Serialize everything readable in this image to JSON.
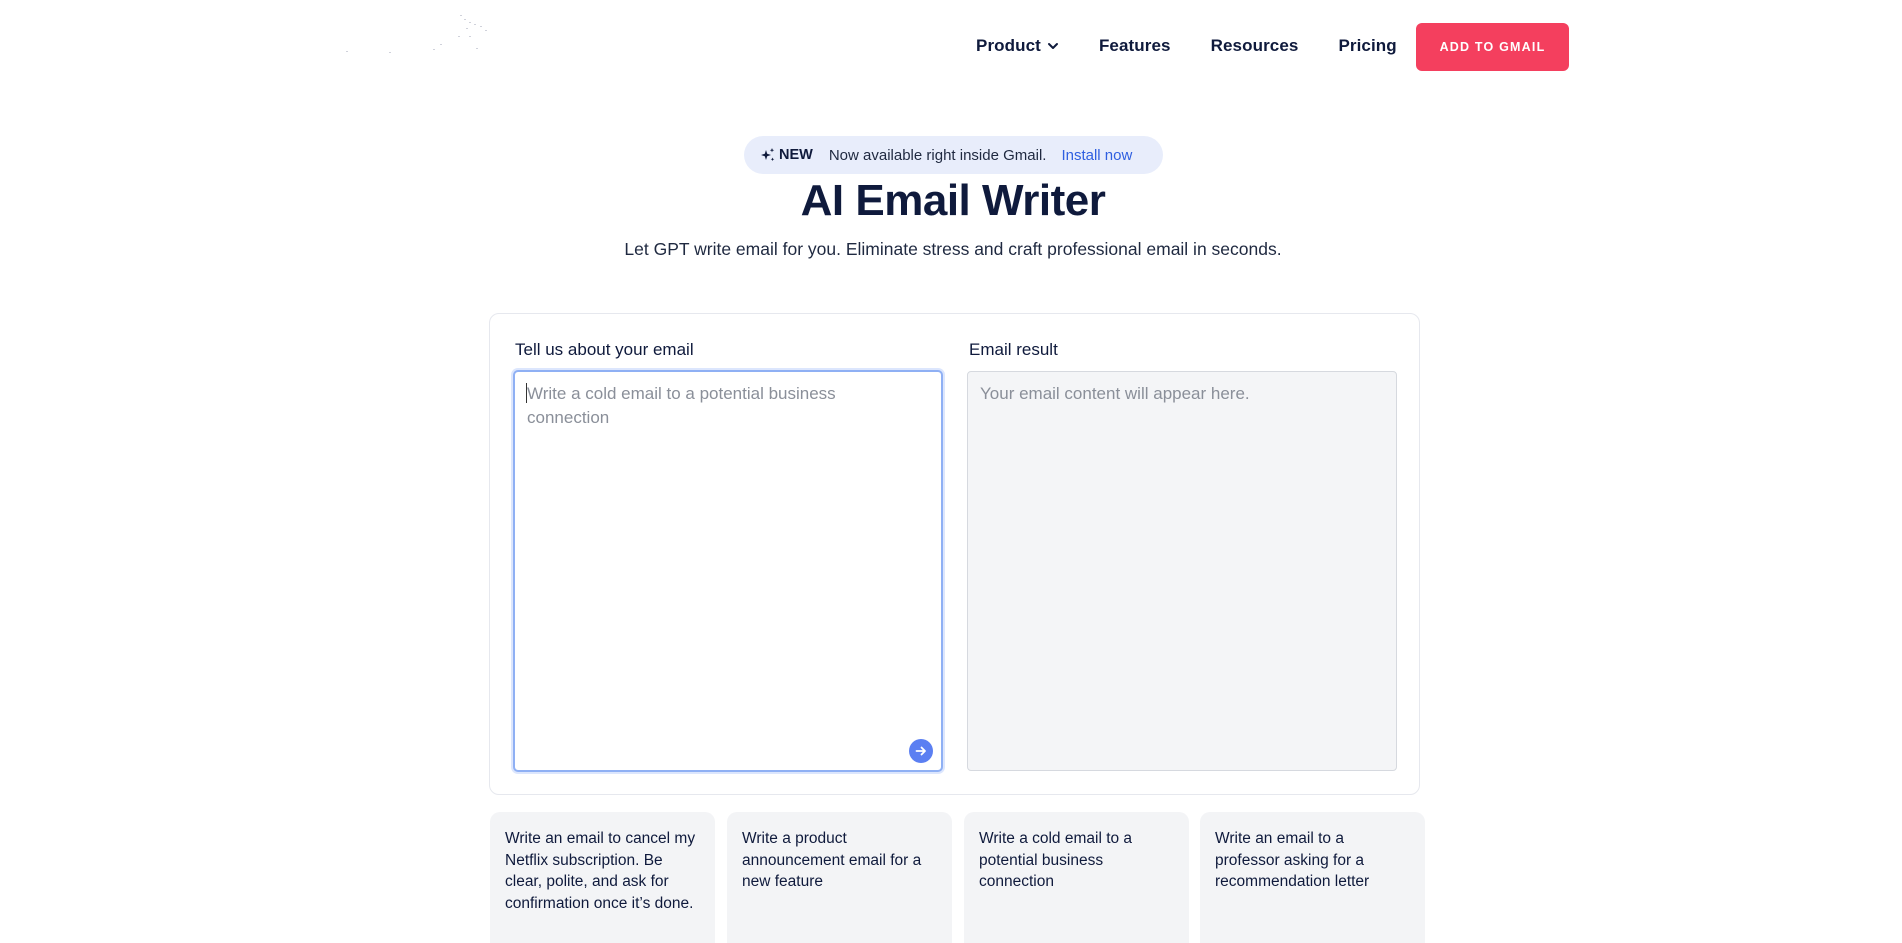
{
  "nav": {
    "items": [
      {
        "label": "Product",
        "has_dropdown": true,
        "icon": "chevron-down-icon"
      },
      {
        "label": "Features"
      },
      {
        "label": "Resources"
      },
      {
        "label": "Pricing"
      }
    ],
    "cta_label": "ADD TO GMAIL",
    "cta_color": "#f43f5e"
  },
  "badge": {
    "icon": "sparkle-icon",
    "tag": "NEW",
    "message": "Now available right inside Gmail.",
    "link": "Install now"
  },
  "hero": {
    "title": "AI Email Writer",
    "subtitle": "Let GPT write email for you. Eliminate stress and craft professional email in seconds."
  },
  "form": {
    "input_label": "Tell us about your email",
    "input_value": "",
    "input_placeholder": "Write a cold email to a potential business connection",
    "send_icon": "arrow-right-icon",
    "result_label": "Email result",
    "result_placeholder": "Your email content will appear here."
  },
  "suggestions": [
    "Write an email to cancel my Netflix subscription. Be clear, polite, and ask for confirmation once it’s done.",
    "Write a product announcement email for a new feature",
    "Write a cold email to a potential business connection",
    "Write an email to a professor asking for a recommendation letter"
  ]
}
